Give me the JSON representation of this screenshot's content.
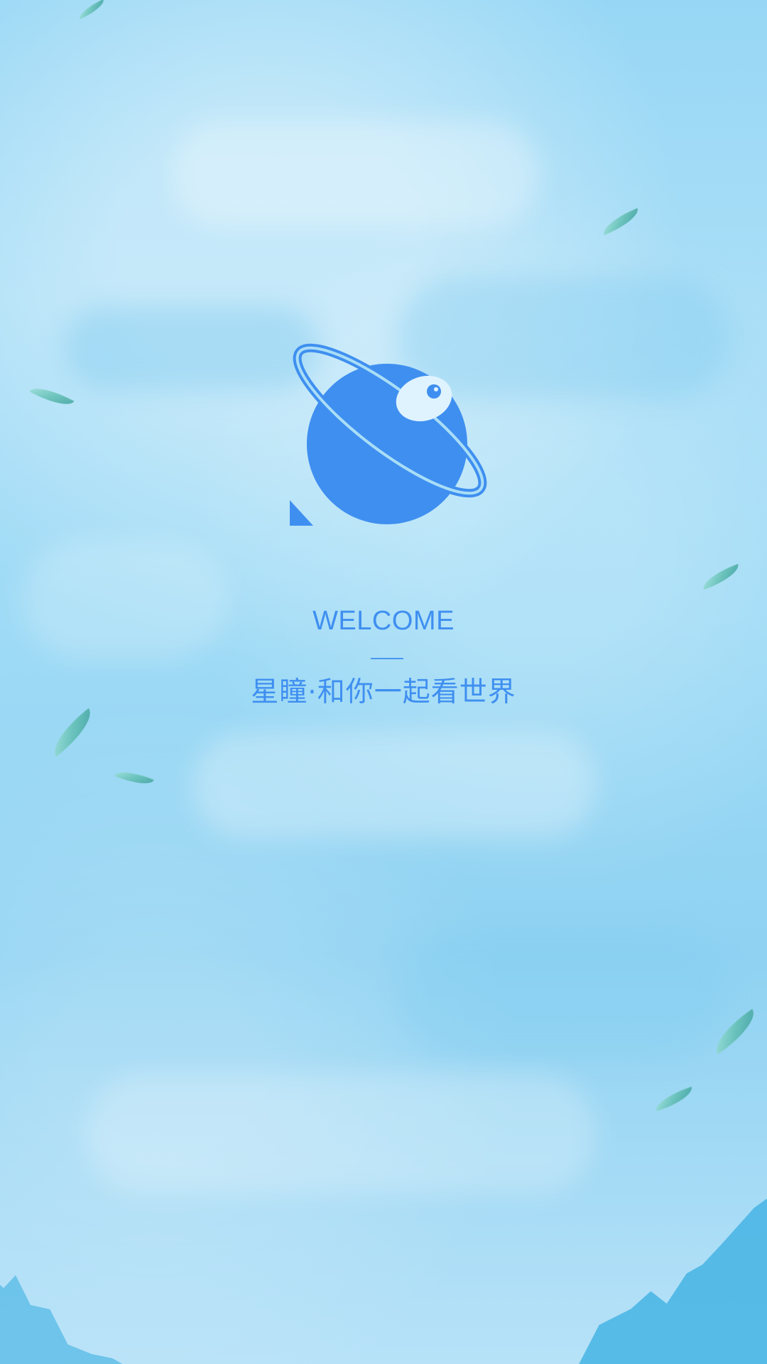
{
  "welcome_screen": {
    "title": "WELCOME",
    "subtitle": "星瞳·和你一起看世界",
    "brand_color": "#3f8ff0",
    "background_color": "#a9def7",
    "leaf_color": "#61beb1",
    "logo_icon": "planet-eye-icon"
  }
}
